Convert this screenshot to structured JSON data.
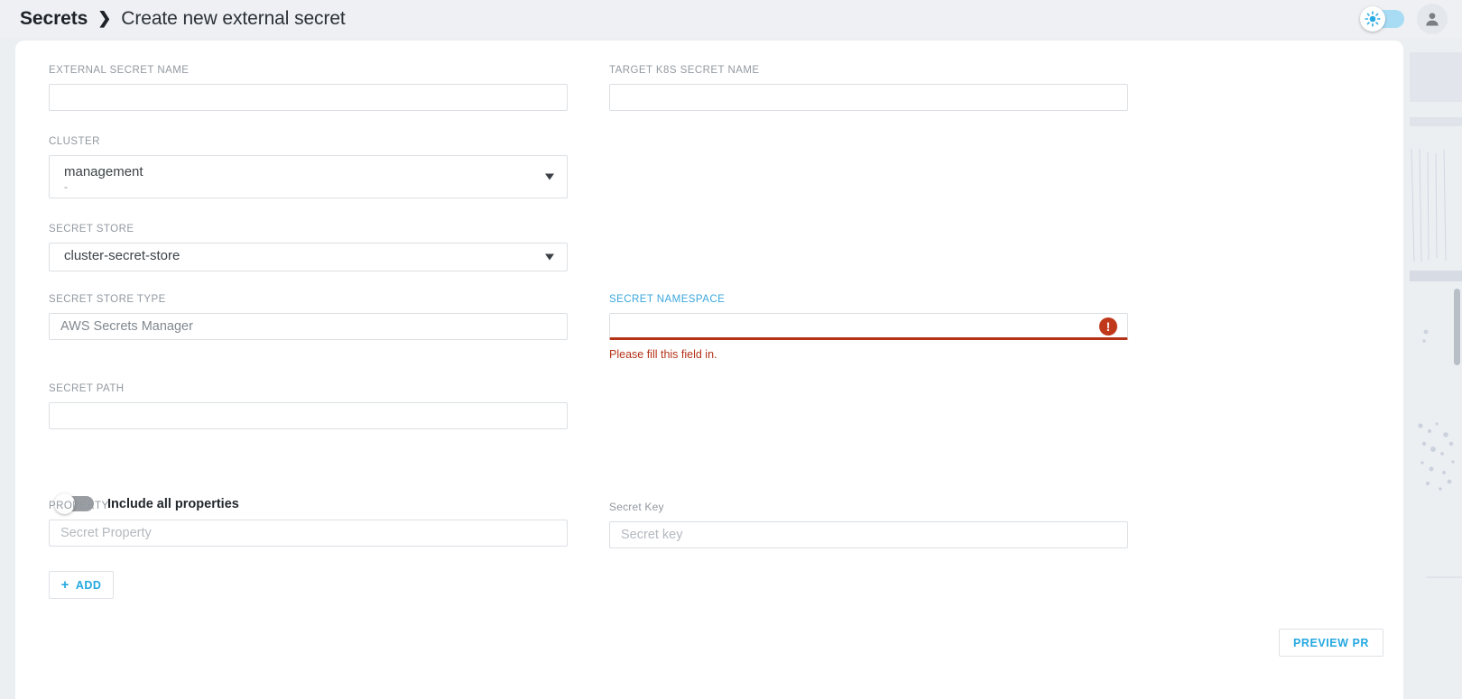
{
  "header": {
    "breadcrumb_root": "Secrets",
    "breadcrumb_separator": "❯",
    "breadcrumb_current": "Create new external secret",
    "theme_toggle_icon": "sun-icon",
    "avatar_icon": "user-icon"
  },
  "form": {
    "external_secret_name": {
      "label": "EXTERNAL SECRET NAME",
      "value": "",
      "placeholder": ""
    },
    "target_k8s_secret_name": {
      "label": "TARGET K8s SECRET NAME",
      "value": "",
      "placeholder": ""
    },
    "cluster": {
      "label": "CLUSTER",
      "value": "management",
      "subvalue": "-",
      "caret_icon": "chevron-down-icon"
    },
    "secret_store": {
      "label": "SECRET STORE",
      "value": "cluster-secret-store",
      "caret_icon": "chevron-down-icon"
    },
    "secret_store_type": {
      "label": "SECRET STORE TYPE",
      "value": "AWS Secrets Manager"
    },
    "secret_namespace": {
      "label": "SECRET NAMESPACE",
      "value": "",
      "error_message": "Please fill this field in.",
      "error_icon": "exclamation-icon",
      "error_glyph": "!"
    },
    "secret_path": {
      "label": "SECRET PATH",
      "value": "",
      "placeholder": ""
    },
    "include_all_properties": {
      "label": "Include all properties",
      "enabled": false
    },
    "property": {
      "label": "PROPERTY",
      "value": "",
      "placeholder": "Secret Property"
    },
    "secret_key": {
      "label": "Secret Key",
      "value": "",
      "placeholder": "Secret key"
    }
  },
  "buttons": {
    "add": "ADD",
    "add_plus": "+",
    "preview_pr": "PREVIEW PR"
  },
  "colors": {
    "accent": "#25a8e0",
    "error": "#b43318",
    "error_icon_bg": "#c0371a",
    "label": "#9299a1",
    "page_bg": "#eceff2",
    "header_bg": "#eef0f3",
    "toggle_on": "#a8dcf5"
  }
}
